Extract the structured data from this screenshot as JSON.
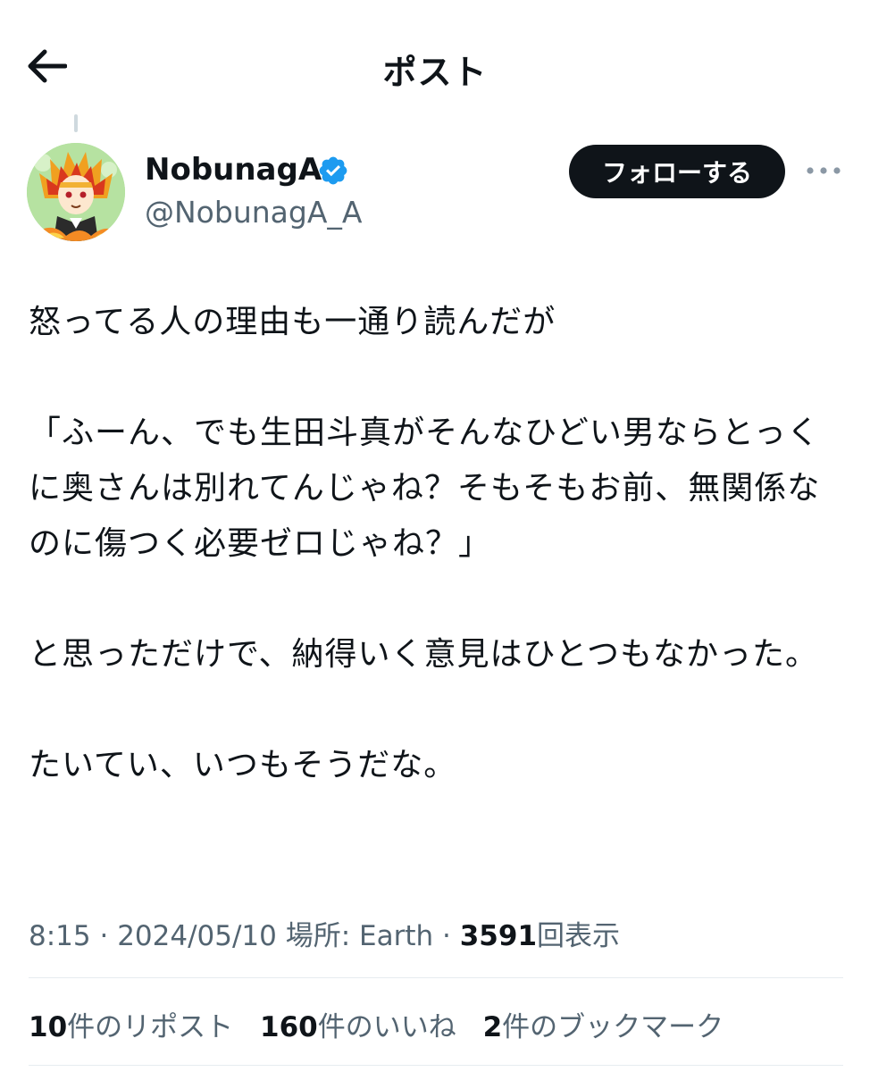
{
  "header": {
    "title": "ポスト",
    "back_icon": "arrow-left-icon"
  },
  "author": {
    "display_name": "NobunagA",
    "handle": "@NobunagA_A",
    "verified": true,
    "verified_color": "#1d9bf0"
  },
  "follow_button": {
    "label": "フォローする"
  },
  "post": {
    "text": "怒ってる人の理由も一通り読んだが\n\n「ふーん、でも生田斗真がそんなひどい男ならとっくに奥さんは別れてんじゃね？そもそもお前、無関係なのに傷つく必要ゼロじゃね？」\n\nと思っただけで、納得いく意見はひとつもなかった。\n\nたいてい、いつもそうだな。"
  },
  "meta": {
    "time": "8:15",
    "date": "2024/05/10",
    "location_label": "場所: Earth",
    "views_count": "3591",
    "views_label": "回表示",
    "separator": " · "
  },
  "stats": {
    "reposts_count": "10",
    "reposts_label": "件のリポスト",
    "likes_count": "160",
    "likes_label": "件のいいね",
    "bookmarks_count": "2",
    "bookmarks_label": "件のブックマーク"
  },
  "colors": {
    "text_primary": "#0f1419",
    "text_secondary": "#536471",
    "button_bg": "#0f1419",
    "divider": "#e6ecf0"
  }
}
